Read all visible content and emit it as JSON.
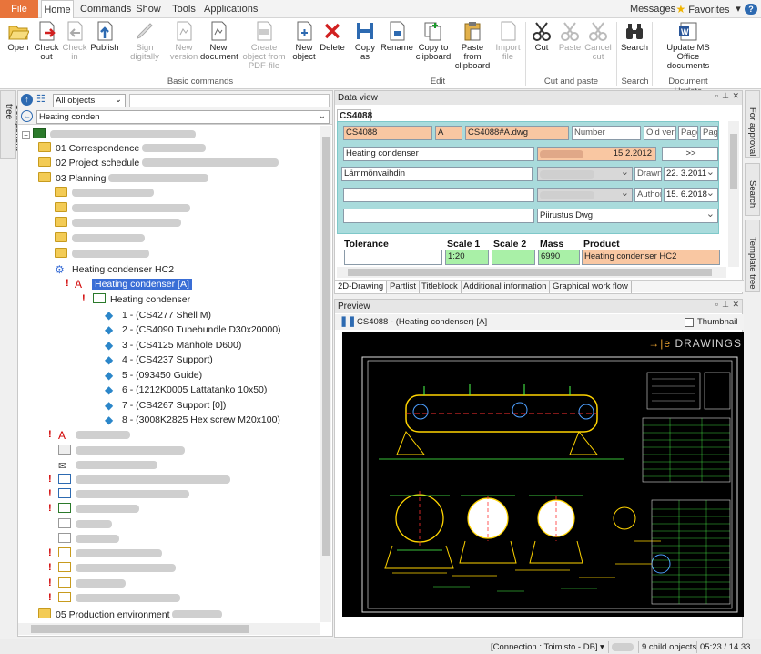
{
  "menubar": {
    "tabs": [
      "File",
      "Home",
      "Commands",
      "Show",
      "Tools",
      "Applications"
    ],
    "messages": "Messages",
    "favorites": "Favorites",
    "help": "?"
  },
  "ribbon": {
    "buttons": [
      {
        "label": "Open"
      },
      {
        "label": "Check out"
      },
      {
        "label": "Check in"
      },
      {
        "label": "Publish"
      },
      {
        "label": "Sign digitally"
      },
      {
        "label": "New version"
      },
      {
        "label": "New document"
      },
      {
        "label": "Create object from PDF-file"
      },
      {
        "label": "New object"
      },
      {
        "label": "Delete"
      },
      {
        "label": "Copy as"
      },
      {
        "label": "Rename"
      },
      {
        "label": "Copy to clipboard"
      },
      {
        "label": "Paste from clipboard"
      },
      {
        "label": "Import file"
      },
      {
        "label": "Cut"
      },
      {
        "label": "Paste"
      },
      {
        "label": "Cancel cut"
      },
      {
        "label": "Search"
      },
      {
        "label": "Update MS Office documents"
      }
    ],
    "groups": [
      "Basic commands",
      "Edit",
      "Cut and paste",
      "Search",
      "Document Update"
    ]
  },
  "left_tab": "Component tree",
  "tree": {
    "filter": "All objects",
    "search_value": "Heating conden",
    "items": [
      {
        "label": "01 Correspondence"
      },
      {
        "label": "02 Project schedule"
      },
      {
        "label": "03 Planning"
      },
      {
        "label": "Heating condenser HC2"
      },
      {
        "label": "Heating condenser [A]"
      },
      {
        "label": "Heating condenser"
      },
      {
        "label": "1 - (CS4277 Shell M)"
      },
      {
        "label": "2 - (CS4090 Tubebundle D30x20000)"
      },
      {
        "label": "3 - (CS4125 Manhole D600)"
      },
      {
        "label": "4 - (CS4237 Support)"
      },
      {
        "label": "5 - (093450 Guide)"
      },
      {
        "label": "6 - (1212K0005 Lattatanko 10x50)"
      },
      {
        "label": "7 - (CS4267 Support  [0])"
      },
      {
        "label": "8 - (3008K2825 Hex screw M20x100)"
      },
      {
        "label": "05 Production environment"
      }
    ]
  },
  "dataview": {
    "title": "Data view",
    "tab": "CS4088",
    "fields": {
      "code": "CS4088",
      "rev": "A",
      "file": "CS4088#A.dwg",
      "number_ph": "Number",
      "old_version_ph": "Old versi",
      "page_ph": "Page",
      "page2_ph": "Page",
      "name": "Heating condenser",
      "date1": "15.2.2012",
      "more": ">>",
      "name_fi": "Lämmönvaihdin",
      "drawn_label": "Drawn",
      "drawn_date": "22. 3.2011",
      "author_label": "Author",
      "author_date": "15. 6.2018",
      "type": "Piirustus Dwg"
    },
    "labels": {
      "tolerance": "Tolerance",
      "scale1": "Scale 1",
      "scale2": "Scale 2",
      "mass": "Mass",
      "product": "Product"
    },
    "values": {
      "tolerance": "",
      "scale1": "1:20",
      "scale2": "",
      "mass": "6990",
      "product": "Heating condenser HC2"
    },
    "tabs": [
      "2D-Drawing",
      "Partlist",
      "Titleblock",
      "Additional information",
      "Graphical work flow"
    ]
  },
  "preview": {
    "title": "Preview",
    "caption": "CS4088 - (Heating condenser) [A]",
    "thumbnail": "Thumbnail",
    "brand": "DRAWINGS"
  },
  "right_tabs": [
    "For approval",
    "Search",
    "Template tree"
  ],
  "status": {
    "connection": "[Connection : Toimisto - DB]",
    "child_objects": "9 child objects",
    "time": "05:23 / 14.33"
  },
  "colors": {
    "file_tab": "#e8743b",
    "selection": "#3a6ed6",
    "form_bg": "#a9dbdc",
    "field_orange": "#f9c7a2",
    "field_green": "#a9f0a7"
  }
}
